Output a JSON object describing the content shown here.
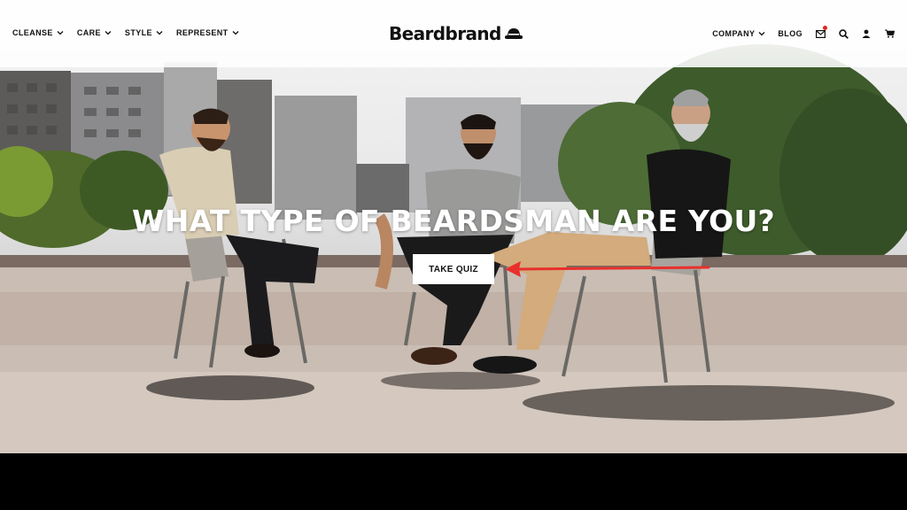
{
  "nav": {
    "left_items": [
      {
        "label": "CLEANSE"
      },
      {
        "label": "CARE"
      },
      {
        "label": "STYLE"
      },
      {
        "label": "REPRESENT"
      }
    ],
    "logo_text": "Beardbrand",
    "company_label": "COMPANY",
    "blog_label": "BLOG",
    "icons": [
      "mail-icon",
      "search-icon",
      "account-icon",
      "cart-icon"
    ]
  },
  "hero": {
    "headline": "WHAT TYPE OF BEARDSMAN ARE YOU?",
    "cta_label": "TAKE QUIZ"
  },
  "colors": {
    "accent_arrow": "#e8302c",
    "notification_dot": "#e32222",
    "headline_text": "#ffffff"
  }
}
